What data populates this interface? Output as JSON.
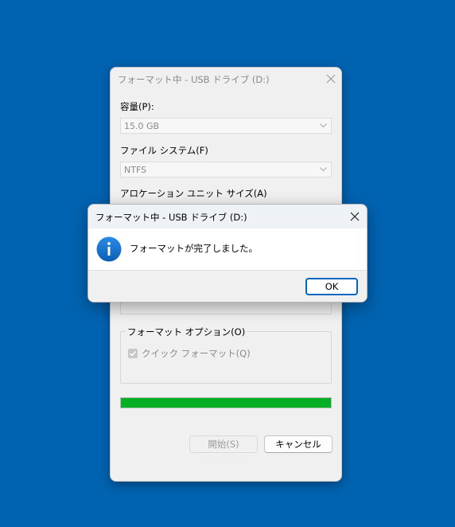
{
  "format_window": {
    "title": "フォーマット中 - USB ドライブ (D:)",
    "capacity_label": "容量(P):",
    "capacity_value": "15.0 GB",
    "filesystem_label": "ファイル システム(F)",
    "filesystem_value": "NTFS",
    "allocation_label": "アロケーション ユニット サイズ(A)",
    "options_group_label": "フォーマット オプション(O)",
    "quick_format_label": "クイック フォーマット(Q)",
    "quick_format_checked": true,
    "progress": 1.0,
    "start_button": "開始(S)",
    "cancel_button": "キャンセル"
  },
  "message_box": {
    "title": "フォーマット中 - USB ドライブ (D:)",
    "message": "フォーマットが完了しました。",
    "icon": "info-icon",
    "ok_button": "OK"
  },
  "colors": {
    "desktop": "#0063b1",
    "progress_fill": "#06b025",
    "accent": "#0067c0"
  }
}
